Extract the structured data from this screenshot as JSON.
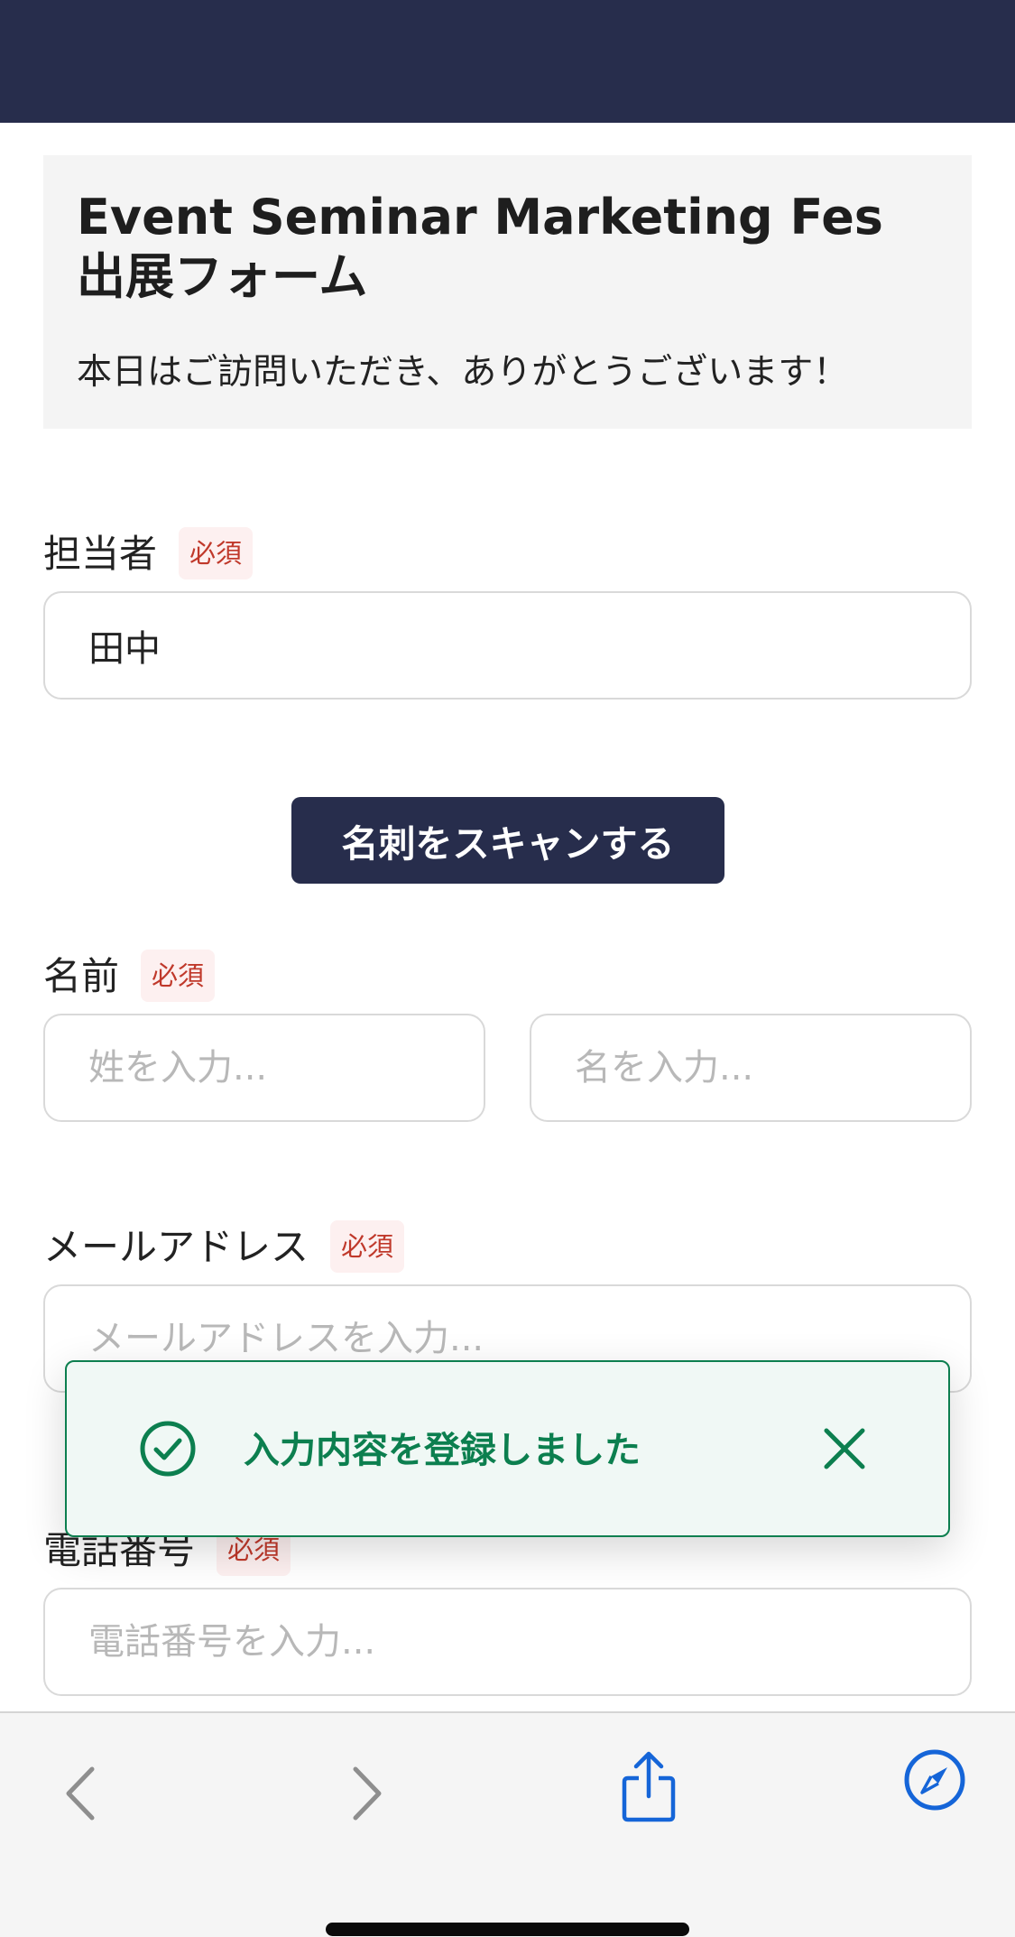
{
  "colors": {
    "navy": "#272d4c",
    "required_red": "#c0392b",
    "success_green": "#0c7f4f",
    "toolbar_bg": "#f5f5f5",
    "ios_blue": "#1565d8",
    "inactive_gray": "#8e8e8e"
  },
  "header": {
    "title": "Event Seminar Marketing Fes出展フォーム",
    "subtitle": "本日はご訪問いただき、ありがとうございます！"
  },
  "fields": {
    "assignee": {
      "label": "担当者",
      "required": "必須",
      "value": "田中"
    },
    "name": {
      "label": "名前",
      "required": "必須",
      "last_placeholder": "姓を入力...",
      "first_placeholder": "名を入力..."
    },
    "email": {
      "label": "メールアドレス",
      "required": "必須",
      "placeholder": "メールアドレスを入力..."
    },
    "phone": {
      "label": "電話番号",
      "required": "必須",
      "placeholder": "電話番号を入力..."
    }
  },
  "scan_button": {
    "label": "名刺をスキャンする"
  },
  "toast": {
    "message": "入力内容を登録しました",
    "icon": "check-circle-icon",
    "close_icon": "close-icon"
  },
  "browser_toolbar": {
    "icons": [
      "back-chevron-icon",
      "forward-chevron-icon",
      "share-icon",
      "compass-icon"
    ]
  }
}
